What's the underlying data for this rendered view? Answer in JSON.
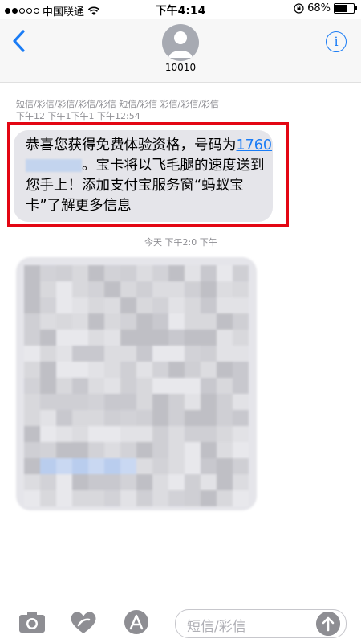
{
  "status_bar": {
    "carrier": "中国联通",
    "time": "下午4:14",
    "battery": "68%"
  },
  "header": {
    "contact_number": "10010",
    "back_icon": "chevron-left-icon",
    "info_icon": "info-icon"
  },
  "history": {
    "line1": "短信/彩信/彩信/彩信/彩信   短信/彩信   彩信/彩信/彩信",
    "line2": "下午12  下午1下午1  下午12:54"
  },
  "message": {
    "text_part1": "恭喜您获得免费体验资格，号码为",
    "phone_prefix": "1760",
    "text_part2": "。宝卡将以飞毛腿的速度送到您手上！添加支付宝服务窗“蚂蚁宝卡”了解更多信息"
  },
  "timestamp": {
    "text": "今天 下午2:0 下午"
  },
  "input_bar": {
    "placeholder": "短信/彩信"
  }
}
